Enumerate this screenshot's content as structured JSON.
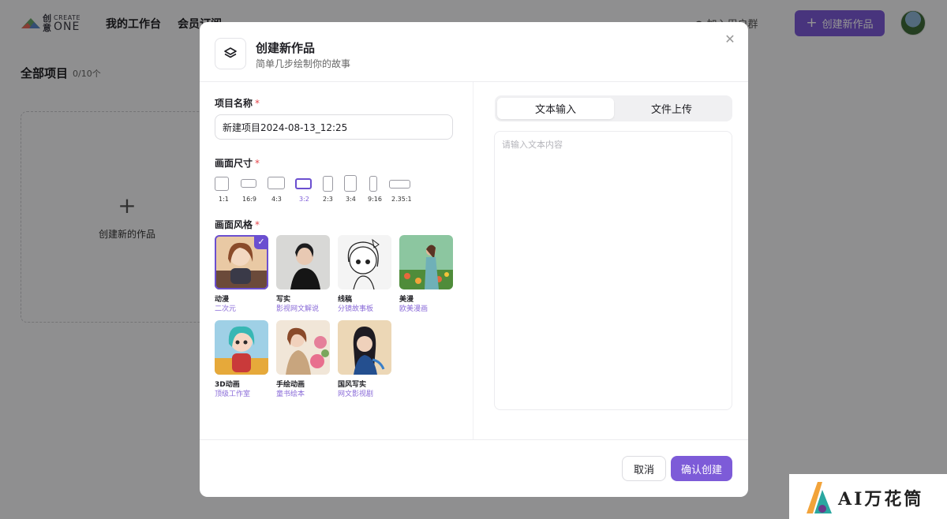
{
  "app": {
    "logo_cn": "创意",
    "logo_en_top": "CREATE",
    "logo_en_bottom": "ONE"
  },
  "nav": {
    "workspace": "我的工作台",
    "membership": "会员订阅",
    "join_group": "加入用户群",
    "create_button": "创建新作品"
  },
  "page": {
    "section_title": "全部项目",
    "project_count": "0/10个",
    "new_card_label": "创建新的作品"
  },
  "modal": {
    "title": "创建新作品",
    "subtitle": "简单几步绘制你的故事",
    "name_label": "项目名称",
    "name_value": "新建项目2024-08-13_12:25",
    "size_label": "画面尺寸",
    "style_label": "画面风格",
    "required_mark": "*",
    "ratios": [
      {
        "label": "1:1",
        "selected": false
      },
      {
        "label": "16:9",
        "selected": false
      },
      {
        "label": "4:3",
        "selected": false
      },
      {
        "label": "3:2",
        "selected": true
      },
      {
        "label": "2:3",
        "selected": false
      },
      {
        "label": "3:4",
        "selected": false
      },
      {
        "label": "9:16",
        "selected": false
      },
      {
        "label": "2.35:1",
        "selected": false
      }
    ],
    "styles": [
      {
        "name": "动漫",
        "desc": "二次元",
        "selected": true
      },
      {
        "name": "写实",
        "desc": "影视网文解说",
        "selected": false
      },
      {
        "name": "线稿",
        "desc": "分镜故事板",
        "selected": false
      },
      {
        "name": "美漫",
        "desc": "欧美漫画",
        "selected": false
      },
      {
        "name": "3D动画",
        "desc": "顶级工作室",
        "selected": false
      },
      {
        "name": "手绘动画",
        "desc": "童书绘本",
        "selected": false
      },
      {
        "name": "国风写实",
        "desc": "网文影视剧",
        "selected": false
      }
    ],
    "tabs": [
      {
        "label": "文本输入",
        "active": true
      },
      {
        "label": "文件上传",
        "active": false
      }
    ],
    "text_placeholder": "请输入文本内容",
    "cancel_label": "取消",
    "confirm_label": "确认创建"
  },
  "watermark": {
    "text": "AI万花筒"
  },
  "colors": {
    "accent": "#7d5bd8",
    "required": "#e5484d"
  }
}
